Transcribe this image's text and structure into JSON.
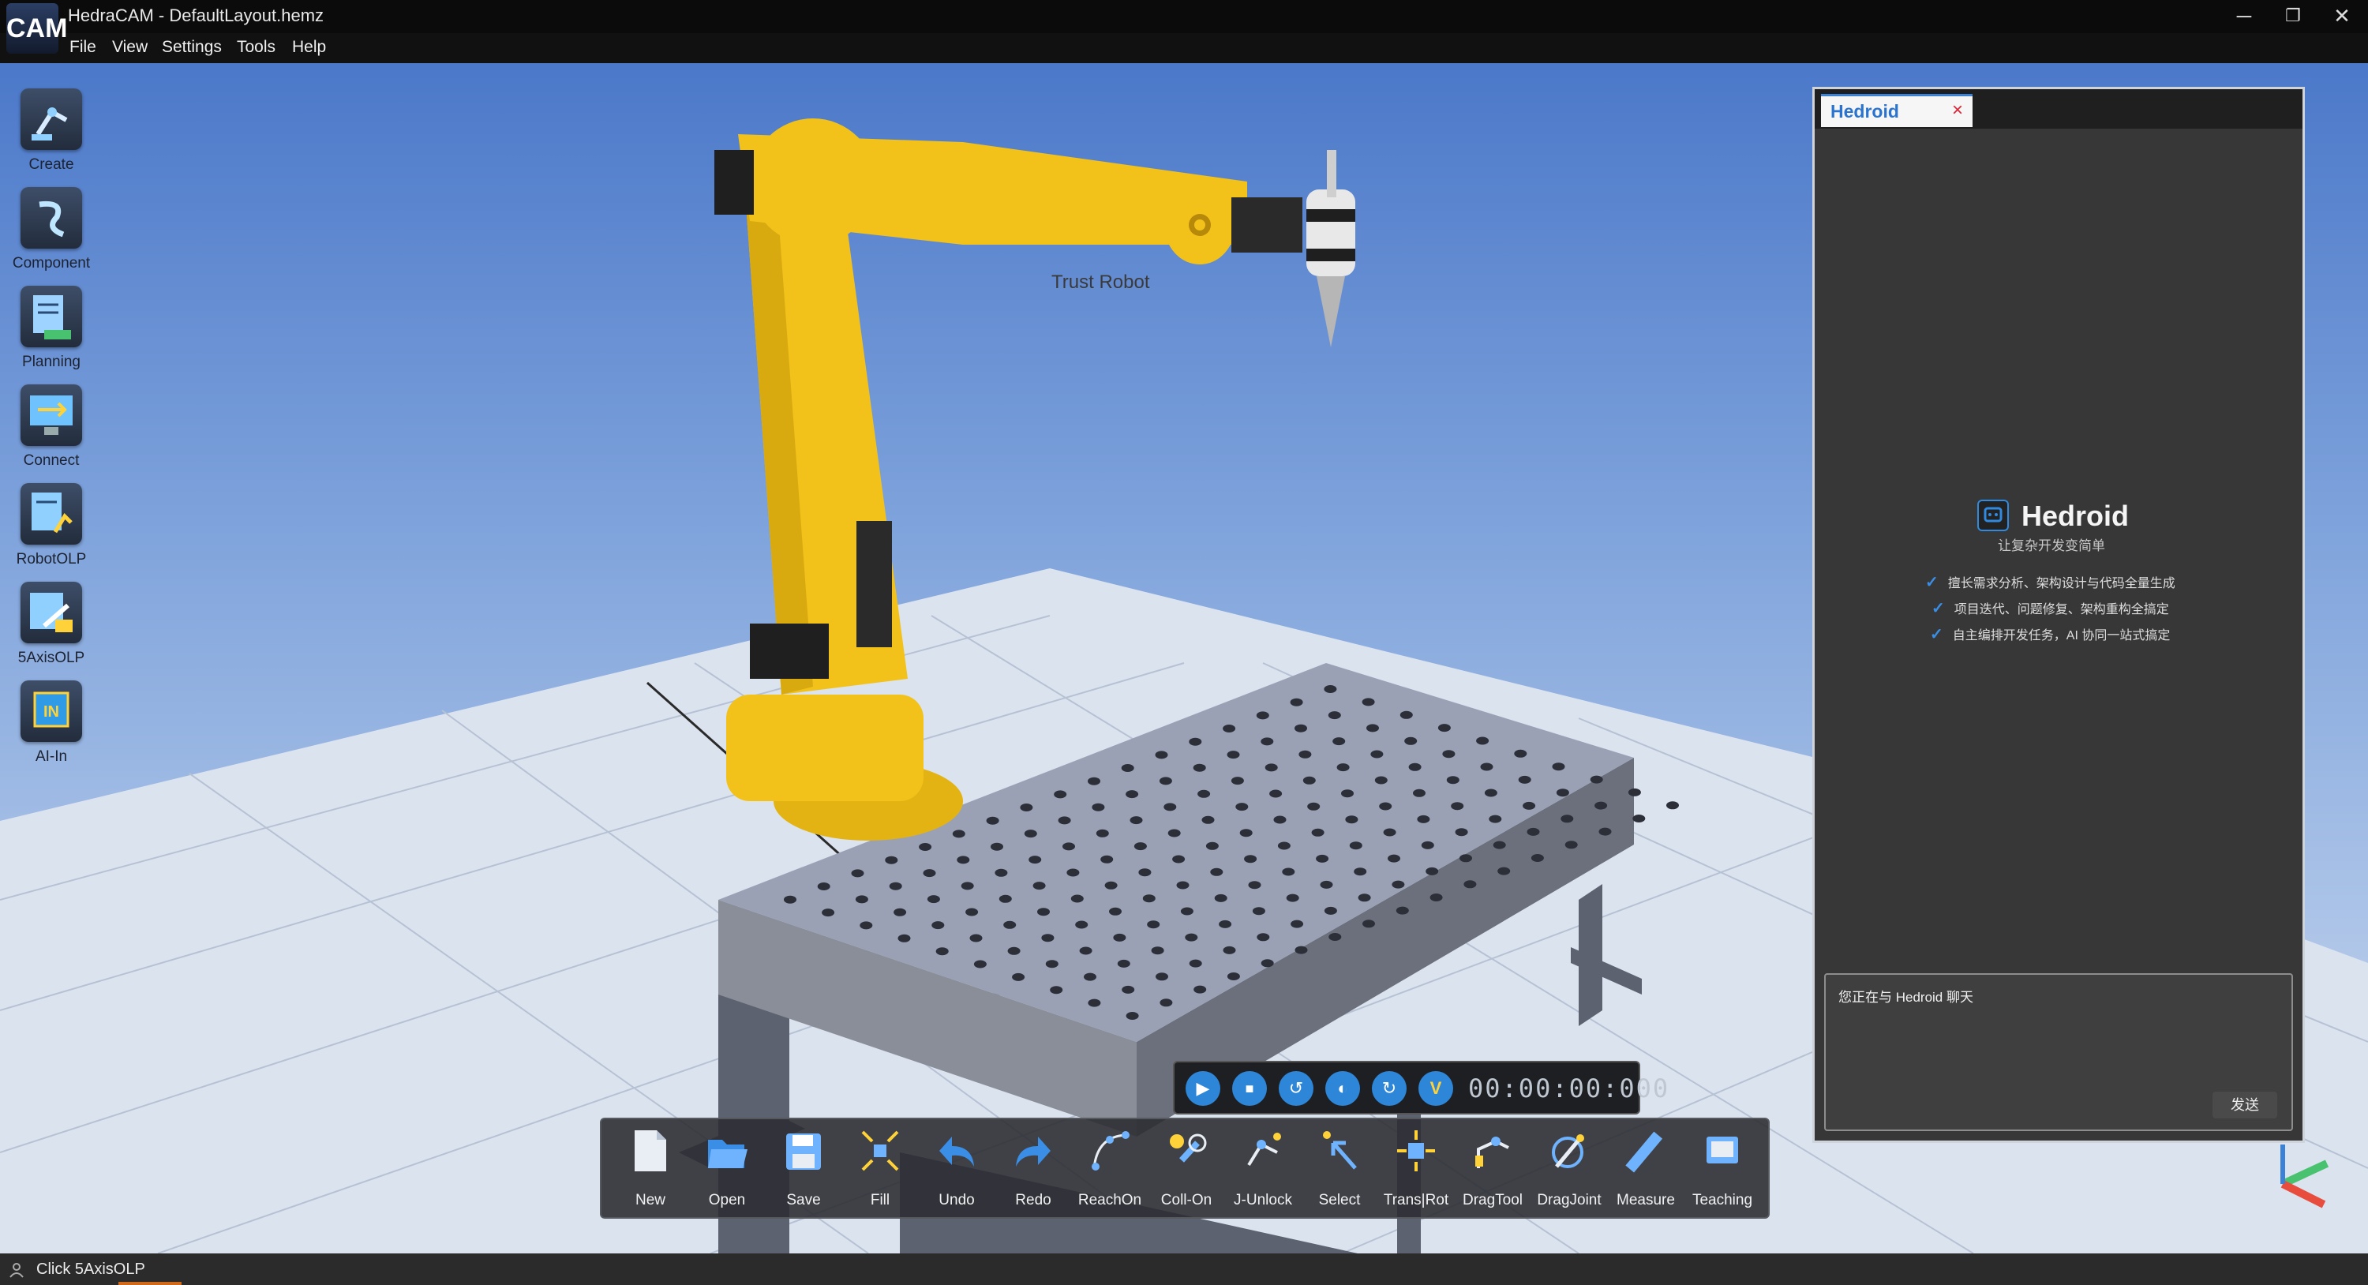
{
  "window": {
    "logo_text": "CAM",
    "title": "HedraCAM - DefaultLayout.hemz",
    "controls": {
      "minimize": "─",
      "restore": "❐",
      "close": "✕"
    }
  },
  "menu": [
    "File",
    "View",
    "Settings",
    "Tools",
    "Help"
  ],
  "left_tools": [
    {
      "label": "Create",
      "icon": "robot-arm-icon"
    },
    {
      "label": "Component",
      "icon": "component-icon"
    },
    {
      "label": "Planning",
      "icon": "planning-icon"
    },
    {
      "label": "Connect",
      "icon": "connect-icon"
    },
    {
      "label": "RobotOLP",
      "icon": "robot-olp-icon"
    },
    {
      "label": "5AxisOLP",
      "icon": "five-axis-olp-icon"
    },
    {
      "label": "AI-In",
      "icon": "ai-in-icon",
      "badge": "IN"
    }
  ],
  "viewport": {
    "robot_label": "Trust Robot"
  },
  "hedroid": {
    "tab_label": "Hedroid",
    "tab_close": "×",
    "name": "Hedroid",
    "tagline": "让复杂开发变简单",
    "features": [
      "擅长需求分析、架构设计与代码全量生成",
      "项目迭代、问题修复、架构重构全搞定",
      "自主编排开发任务，AI 协同一站式搞定"
    ],
    "chat_text": "您正在与 Hedroid 聊天",
    "send_label": "发送"
  },
  "playback": {
    "buttons": [
      {
        "name": "play-icon",
        "glyph": "▶"
      },
      {
        "name": "stop-icon",
        "glyph": "■"
      },
      {
        "name": "rewind-icon",
        "glyph": "↺"
      },
      {
        "name": "timer-icon",
        "glyph": "◐"
      },
      {
        "name": "forward-icon",
        "glyph": "↻"
      },
      {
        "name": "speed-icon",
        "glyph": "V"
      }
    ],
    "time": "00:00:00:000"
  },
  "toolbar": [
    {
      "label": "New",
      "icon": "new-file-icon"
    },
    {
      "label": "Open",
      "icon": "open-folder-icon"
    },
    {
      "label": "Save",
      "icon": "save-icon"
    },
    {
      "label": "Fill",
      "icon": "fill-icon"
    },
    {
      "label": "Undo",
      "icon": "undo-icon"
    },
    {
      "label": "Redo",
      "icon": "redo-icon"
    },
    {
      "label": "ReachOn",
      "icon": "reach-on-icon"
    },
    {
      "label": "Coll-On",
      "icon": "collision-on-icon"
    },
    {
      "label": "J-Unlock",
      "icon": "joint-unlock-icon"
    },
    {
      "label": "Select",
      "icon": "select-icon"
    },
    {
      "label": "Trans|Rot",
      "icon": "trans-rot-icon"
    },
    {
      "label": "DragTool",
      "icon": "drag-tool-icon"
    },
    {
      "label": "DragJoint",
      "icon": "drag-joint-icon"
    },
    {
      "label": "Measure",
      "icon": "measure-icon"
    },
    {
      "label": "Teaching",
      "icon": "teaching-icon"
    }
  ],
  "status": {
    "text": "Click 5AxisOLP",
    "icon": "person-icon"
  },
  "colors": {
    "accent": "#2e86d8",
    "robot_yellow": "#f2c21b",
    "panel": "#373737"
  }
}
